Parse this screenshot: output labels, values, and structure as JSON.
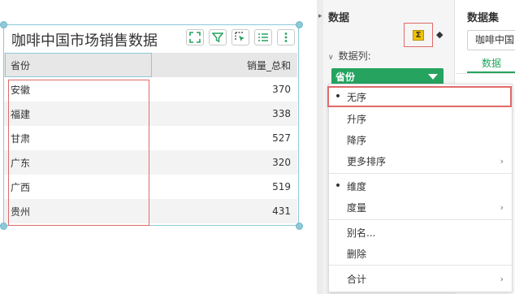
{
  "widget": {
    "title": "咖啡中国市场销售数据",
    "columns": [
      "省份",
      "销量_总和"
    ],
    "rows": [
      {
        "province": "安徽",
        "value": "370"
      },
      {
        "province": "福建",
        "value": "338"
      },
      {
        "province": "甘肃",
        "value": "527"
      },
      {
        "province": "广东",
        "value": "320"
      },
      {
        "province": "广西",
        "value": "519"
      },
      {
        "province": "贵州",
        "value": "431"
      }
    ],
    "toolbar_icons": [
      "expand-icon",
      "filter-icon",
      "cursor-select-icon",
      "list-icon",
      "more-vertical-icon"
    ]
  },
  "data_panel": {
    "title": "数据",
    "sigma_symbol": "Σ",
    "section_label": "数据列:",
    "field_pill": "省份"
  },
  "dataset_panel": {
    "title": "数据集",
    "selected_dataset": "咖啡中国市场销售数据",
    "tab_label": "数据"
  },
  "context_menu": {
    "items": [
      {
        "label": "无序",
        "checked": true,
        "submenu": false
      },
      {
        "label": "升序",
        "checked": false,
        "submenu": false
      },
      {
        "label": "降序",
        "checked": false,
        "submenu": false
      },
      {
        "label": "更多排序",
        "checked": false,
        "submenu": true
      },
      {
        "label": "维度",
        "checked": true,
        "submenu": false
      },
      {
        "label": "度量",
        "checked": false,
        "submenu": true
      },
      {
        "label": "别名...",
        "checked": false,
        "submenu": false
      },
      {
        "label": "删除",
        "checked": false,
        "submenu": false
      },
      {
        "label": "合计",
        "checked": false,
        "submenu": true
      }
    ],
    "bullet": "•",
    "submenu_arrow": "›"
  },
  "colors": {
    "accent_green": "#25a35f",
    "selection_blue": "#8ec9d8",
    "highlight_red": "#e06a6a",
    "sigma_yellow": "#f2c200"
  }
}
